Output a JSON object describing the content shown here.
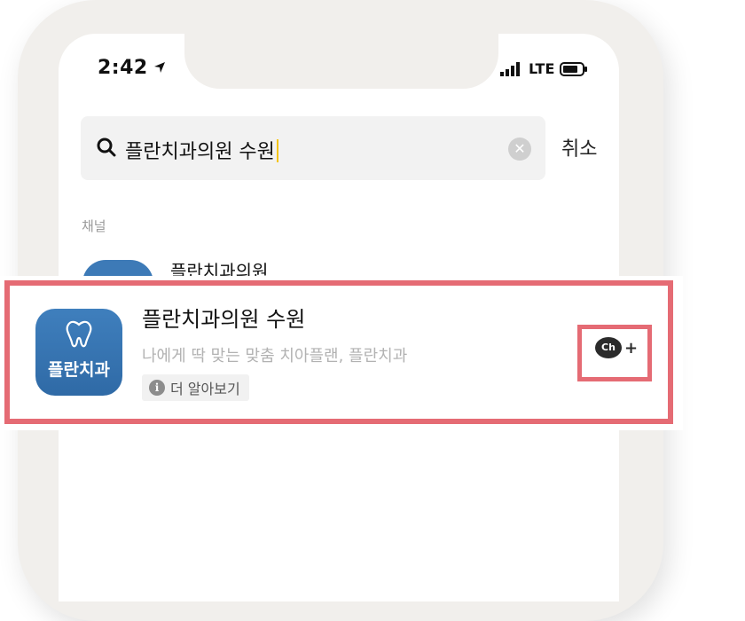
{
  "status_bar": {
    "time": "2:42",
    "network": "LTE"
  },
  "search": {
    "query": "플란치과의원 수원",
    "cancel_label": "취소"
  },
  "results": {
    "section_label": "채널",
    "background_item": {
      "name": "플란치과의원"
    },
    "highlighted_item": {
      "logo_text": "플란치과",
      "name": "플란치과의원 수원",
      "description": "나에게 딱 맞는 맞춤 치아플랜, 플란치과",
      "learn_more_label": "더 알아보기",
      "add_channel_label": "Ch"
    }
  },
  "colors": {
    "highlight_red": "#e56b74",
    "logo_blue": "#3d7ab7",
    "caret_yellow": "#f5c518"
  }
}
